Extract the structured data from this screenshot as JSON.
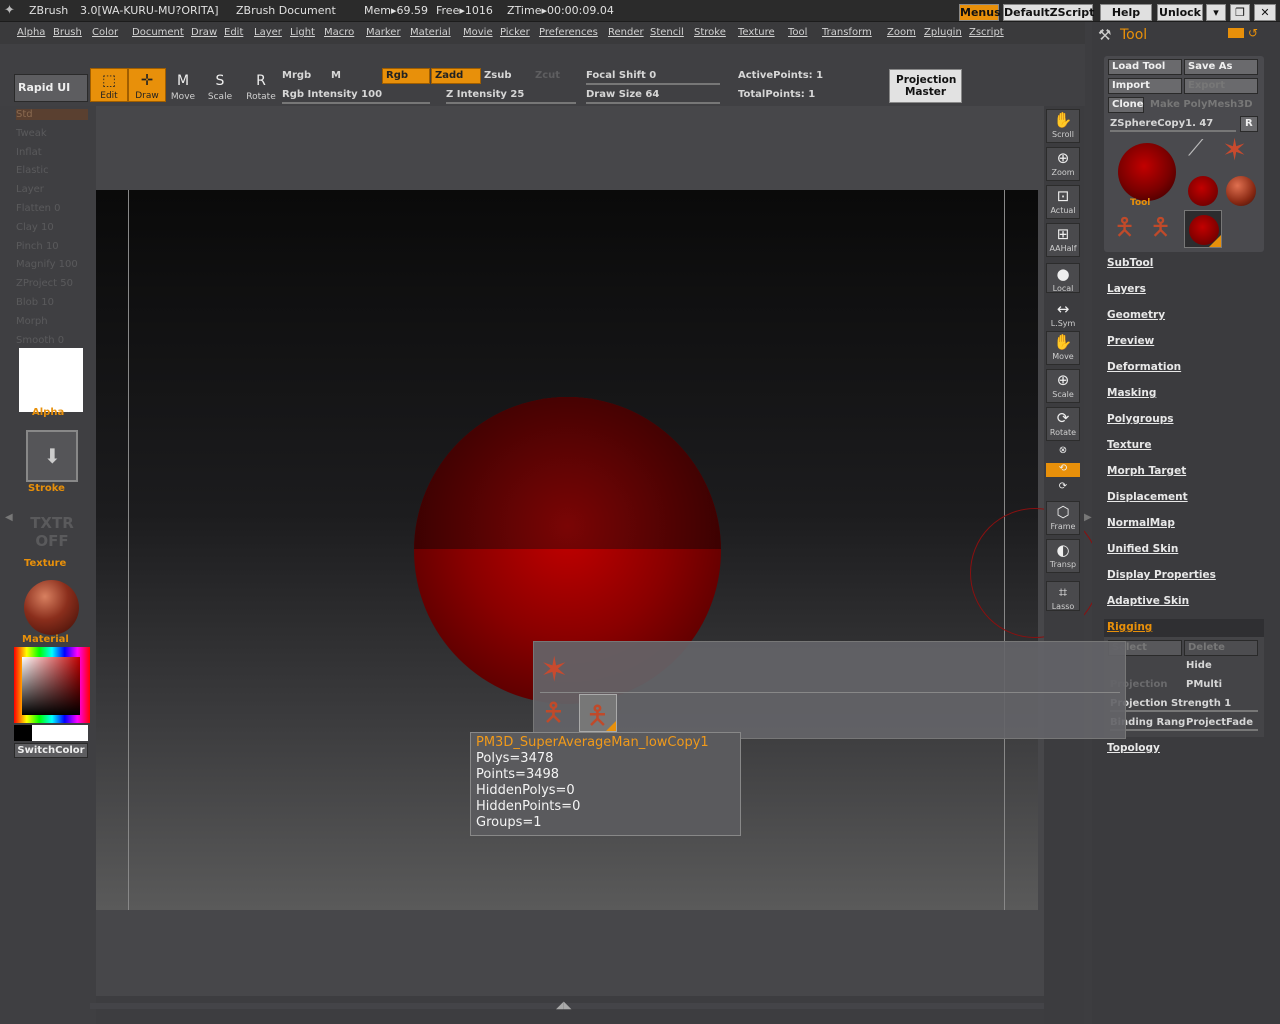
{
  "titlebar": {
    "app": "ZBrush",
    "version_info": "3.0[WA-KURU-MU?ORITA]",
    "document": "ZBrush Document",
    "mem": "Mem▸69.59",
    "free": "Free▸1016",
    "ztime": "ZTime▸00:00:09.04",
    "buttons": {
      "menus": "Menus",
      "defaultzscript": "DefaultZScript",
      "help": "Help",
      "unlock": "Unlock"
    }
  },
  "menubar": [
    "Alpha",
    "Brush",
    "Color",
    "Document",
    "Draw",
    "Edit",
    "Layer",
    "Light",
    "Macro",
    "Marker",
    "Material",
    "Movie",
    "Picker",
    "Preferences",
    "Render",
    "Stencil",
    "Stroke",
    "Texture",
    "Tool",
    "Transform",
    "Zoom",
    "Zplugin",
    "Zscript"
  ],
  "topshelf": {
    "rapid_ui": "Rapid UI",
    "edit": "Edit",
    "draw": "Draw",
    "move": "Move",
    "scale": "Scale",
    "rotate": "Rotate",
    "mrgb": "Mrgb",
    "m": "M",
    "rgb": "Rgb",
    "zadd": "Zadd",
    "zsub": "Zsub",
    "zcut": "Zcut",
    "rgb_intensity": "Rgb Intensity 100",
    "z_intensity": "Z Intensity 25",
    "focal_shift": "Focal Shift 0",
    "draw_size": "Draw Size 64",
    "active_points": "ActivePoints: 1",
    "total_points": "TotalPoints: 1",
    "projection_master": "Projection Master"
  },
  "leftshelf": {
    "brushes": [
      "Std",
      "Tweak",
      "Inflat",
      "Elastic",
      "Layer",
      "Flatten 0",
      "Clay 10",
      "Pinch 10",
      "Magnify 100",
      "ZProject 50",
      "Blob 10",
      "Morph",
      "Smooth 0"
    ],
    "alpha": "Alpha",
    "stroke": "Stroke",
    "texture_off": "TXTR OFF",
    "texture": "Texture",
    "material": "Material",
    "switchcolor": "SwitchColor"
  },
  "rightshelf": [
    "Scroll",
    "Zoom",
    "Actual",
    "AAHalf",
    "Local",
    "L.Sym",
    "Move",
    "Scale",
    "Rotate",
    "XYZ",
    "",
    "",
    "Frame",
    "Transp",
    "Lasso"
  ],
  "toolpanel": {
    "title": "Tool",
    "load_tool": "Load Tool",
    "save_as": "Save As",
    "import": "Import",
    "export": "Export",
    "clone": "Clone",
    "make_polymesh": "Make PolyMesh3D",
    "current_tool": "ZSphereCopy1. 47",
    "r": "R",
    "tool_label": "Tool",
    "sections": [
      "SubTool",
      "Layers",
      "Geometry",
      "Preview",
      "Deformation",
      "Masking",
      "Polygroups",
      "Texture",
      "Morph Target",
      "Displacement",
      "NormalMap",
      "Unified Skin",
      "Display Properties",
      "Adaptive Skin"
    ],
    "rigging": "Rigging",
    "rigging_items": {
      "select": "Select",
      "delete": "Delete",
      "hide": "Hide",
      "projection": "Projection",
      "pmulti": "PMulti",
      "projection_strength": "Projection Strength 1",
      "binding_range": "Binding Rang",
      "projectfade": "ProjectFade"
    },
    "topology": "Topology"
  },
  "tooltip": {
    "name": "PM3D_SuperAverageMan_lowCopy1",
    "polys": "Polys=3478",
    "points": "Points=3498",
    "hiddenpolys": "HiddenPolys=0",
    "hiddenpoints": "HiddenPoints=0",
    "groups": "Groups=1"
  },
  "colors": {
    "accent": "#e8900a",
    "sphere": "#b00000"
  }
}
